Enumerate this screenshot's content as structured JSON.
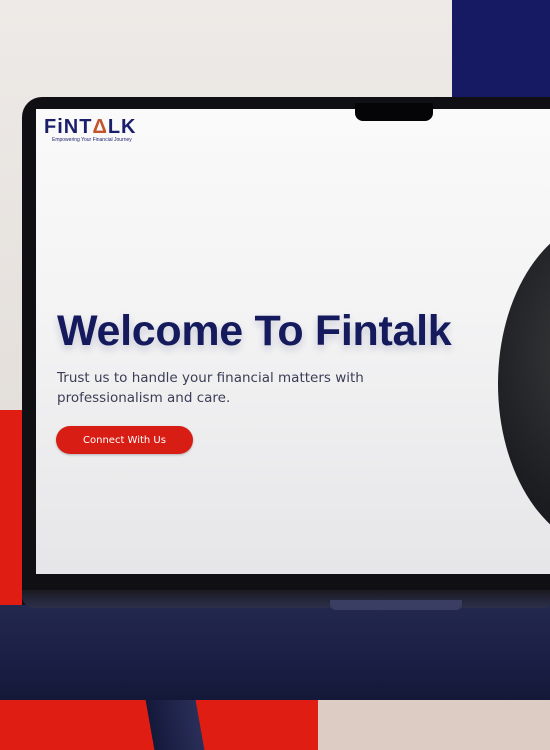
{
  "brand": {
    "logo_prefix": "FiNT",
    "logo_accent": "Δ",
    "logo_suffix": "LK",
    "tagline": "Empowering Your Financial Journey"
  },
  "hero": {
    "title": "Welcome To Fintalk",
    "subtitle": "Trust us to handle your financial matters with professionalism and care.",
    "cta_label": "Connect With Us"
  },
  "colors": {
    "navy": "#141a5c",
    "brand_red": "#d81e14",
    "accent_orange": "#c4522a"
  }
}
